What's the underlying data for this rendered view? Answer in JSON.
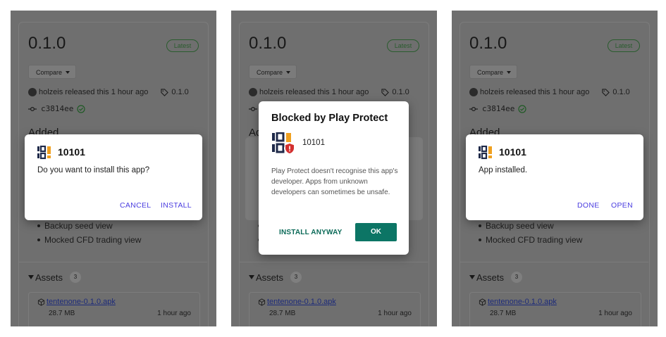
{
  "release": {
    "version": "0.1.0",
    "latest_badge": "Latest",
    "compare_label": "Compare",
    "author_text": "holzeis released this 1 hour ago",
    "tag": "0.1.0",
    "commit": "c3814ee",
    "added_heading": "Added",
    "changes": [
      "Backup seed view",
      "Mocked CFD trading view"
    ],
    "assets_label": "Assets",
    "assets_count": "3",
    "asset": {
      "name": "tentenone-0.1.0.apk",
      "size": "28.7 MB",
      "time": "1 hour ago"
    }
  },
  "screen1": {
    "app_name": "10101",
    "message": "Do you want to install this app?",
    "cancel_label": "CANCEL",
    "install_label": "INSTALL"
  },
  "screen2": {
    "title": "Blocked by Play Protect",
    "app_name": "10101",
    "description": "Play Protect doesn't recognise this app's developer. Apps from unknown developers can sometimes be unsafe.",
    "install_anyway_label": "INSTALL ANYWAY",
    "ok_label": "OK"
  },
  "screen3": {
    "app_name": "10101",
    "message": "App installed.",
    "done_label": "DONE",
    "open_label": "OPEN"
  },
  "icons": {
    "app_logo": "app-logo-icon",
    "tag": "tag-icon",
    "commit": "git-commit-icon",
    "verified": "check-circle-icon",
    "package": "package-icon",
    "dropdown": "chevron-down-icon",
    "shield": "shield-alert-icon"
  },
  "colors": {
    "accent_button_text": "#4a3de0",
    "play_protect_green": "#0c7565",
    "shield_red": "#d32f2f",
    "logo_navy": "#1f2a4a",
    "logo_orange": "#f0a020"
  }
}
